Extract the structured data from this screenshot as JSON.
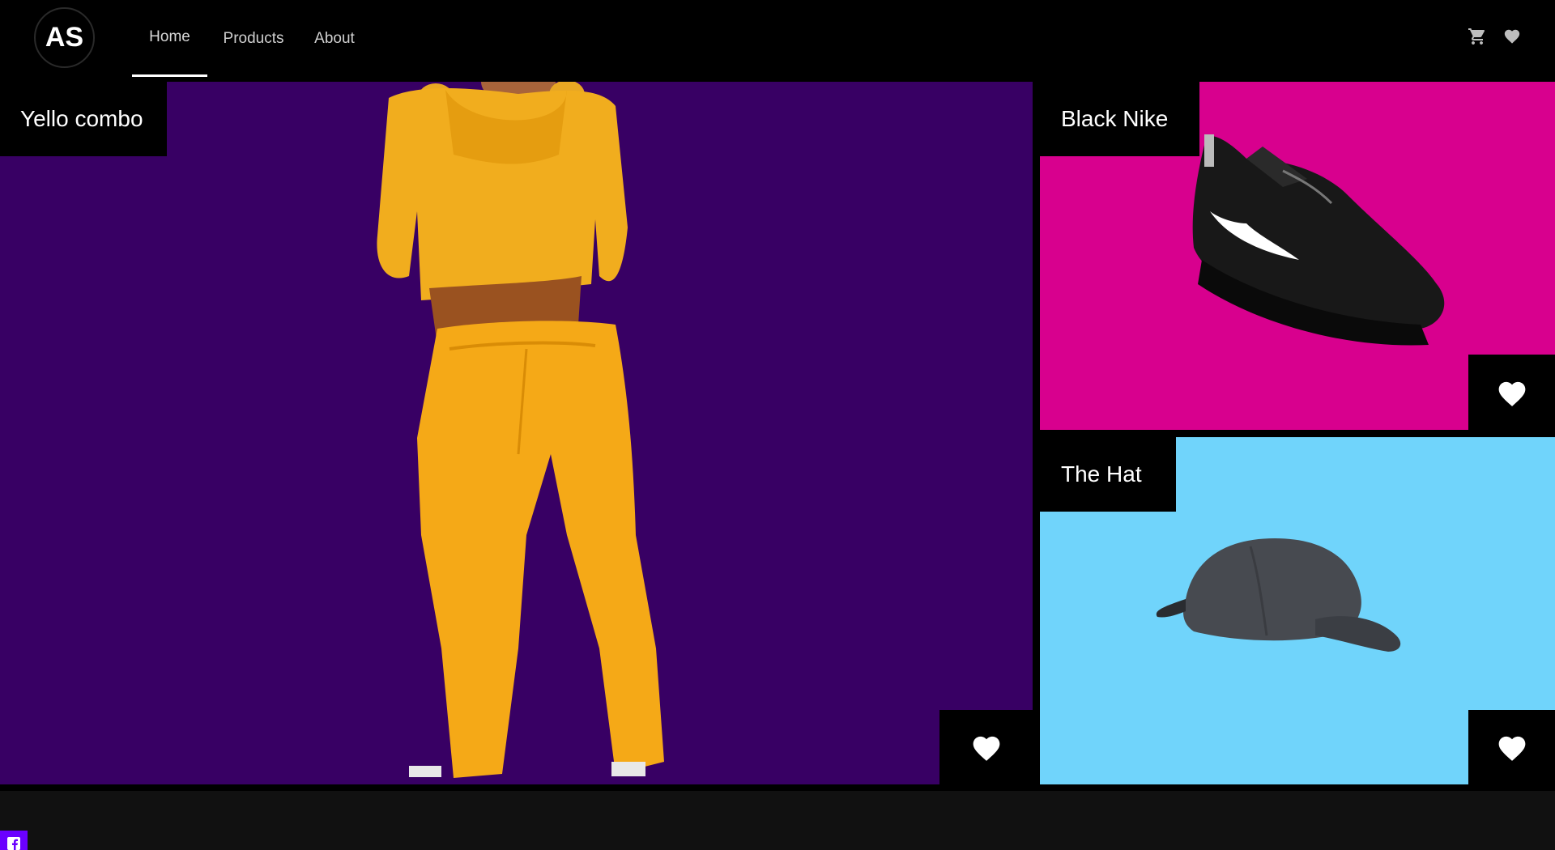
{
  "brand": {
    "logo_text": "AS"
  },
  "nav": {
    "items": [
      {
        "label": "Home",
        "active": true
      },
      {
        "label": "Products",
        "active": false
      },
      {
        "label": "About",
        "active": false
      }
    ]
  },
  "header_icons": [
    "cart-icon",
    "heart-icon"
  ],
  "products": [
    {
      "title": "Yello combo",
      "background": "#380064",
      "image": "model-in-yellow-tracksuit"
    },
    {
      "title": "Black Nike",
      "background": "#d8008e",
      "image": "black-nike-sneaker"
    },
    {
      "title": "The Hat",
      "background": "#70d4fb",
      "image": "grey-cap"
    }
  ],
  "footer": {
    "social_icon": "facebook-icon",
    "social_color": "#6a00ff"
  }
}
